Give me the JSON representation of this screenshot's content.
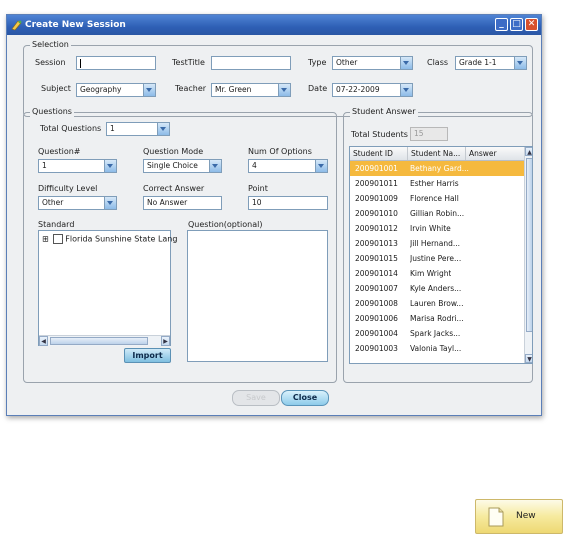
{
  "window": {
    "title": "Create New Session"
  },
  "selection": {
    "group_title": "Selection",
    "session_label": "Session",
    "session_value": "",
    "test_title_label": "TestTitle",
    "test_title_value": "",
    "type_label": "Type",
    "type_value": "Other",
    "class_label": "Class",
    "class_value": "Grade 1-1",
    "subject_label": "Subject",
    "subject_value": "Geography",
    "teacher_label": "Teacher",
    "teacher_value": "Mr. Green",
    "date_label": "Date",
    "date_value": "07-22-2009"
  },
  "questions": {
    "group_title": "Questions",
    "total_label": "Total Questions",
    "total_value": "1",
    "question_num_label": "Question#",
    "question_num_value": "1",
    "mode_label": "Question Mode",
    "mode_value": "Single Choice",
    "options_label": "Num Of Options",
    "options_value": "4",
    "difficulty_label": "Difficulty Level",
    "difficulty_value": "Other",
    "correct_label": "Correct Answer",
    "correct_value": "No Answer",
    "point_label": "Point",
    "point_value": "10",
    "standard_label": "Standard",
    "standard_tree_item": "Florida Sunshine State Lang",
    "tree_expander": "⊞",
    "question_optional_label": "Question(optional)",
    "import_label": "Import"
  },
  "student_answer": {
    "group_title": "Student Answer",
    "total_students_label": "Total Students",
    "total_students_value": "15",
    "columns": [
      "Student ID",
      "Student Na...",
      "Answer"
    ],
    "rows": [
      {
        "id": "200901001",
        "name": "Bethany Gard...",
        "answer": ""
      },
      {
        "id": "200901011",
        "name": "Esther Harris",
        "answer": ""
      },
      {
        "id": "200901009",
        "name": "Florence Hall",
        "answer": ""
      },
      {
        "id": "200901010",
        "name": "Gillian Robin...",
        "answer": ""
      },
      {
        "id": "200901012",
        "name": "Irvin White",
        "answer": ""
      },
      {
        "id": "200901013",
        "name": "Jill Hernand...",
        "answer": ""
      },
      {
        "id": "200901015",
        "name": "Justine Pere...",
        "answer": ""
      },
      {
        "id": "200901014",
        "name": "Kim Wright",
        "answer": ""
      },
      {
        "id": "200901007",
        "name": "Kyle Anders...",
        "answer": ""
      },
      {
        "id": "200901008",
        "name": "Lauren Brow...",
        "answer": ""
      },
      {
        "id": "200901006",
        "name": "Marisa Rodri...",
        "answer": ""
      },
      {
        "id": "200901004",
        "name": "Spark Jacks...",
        "answer": ""
      },
      {
        "id": "200901003",
        "name": "Valonia Tayl...",
        "answer": ""
      }
    ],
    "selected_row": 0
  },
  "footer": {
    "save_label": "Save",
    "close_label": "Close"
  },
  "outside": {
    "new_label": "New"
  },
  "colors": {
    "title_bar": "#2e5fb5",
    "selected_row": "#f5b93e",
    "close_btn": "#d8512e"
  }
}
